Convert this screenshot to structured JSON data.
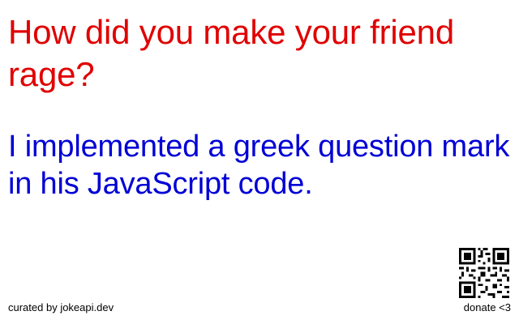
{
  "joke": {
    "setup": "How did you make your friend rage?",
    "delivery": "I implemented a greek question mark in his JavaScript code."
  },
  "footer": {
    "curated_by": "curated by jokeapi.dev",
    "donate": "donate <3"
  },
  "colors": {
    "setup": "#e00000",
    "delivery": "#0000d6",
    "background": "#ffffff",
    "footer_text": "#000000"
  },
  "icons": {
    "qr": "qr-code-icon"
  }
}
